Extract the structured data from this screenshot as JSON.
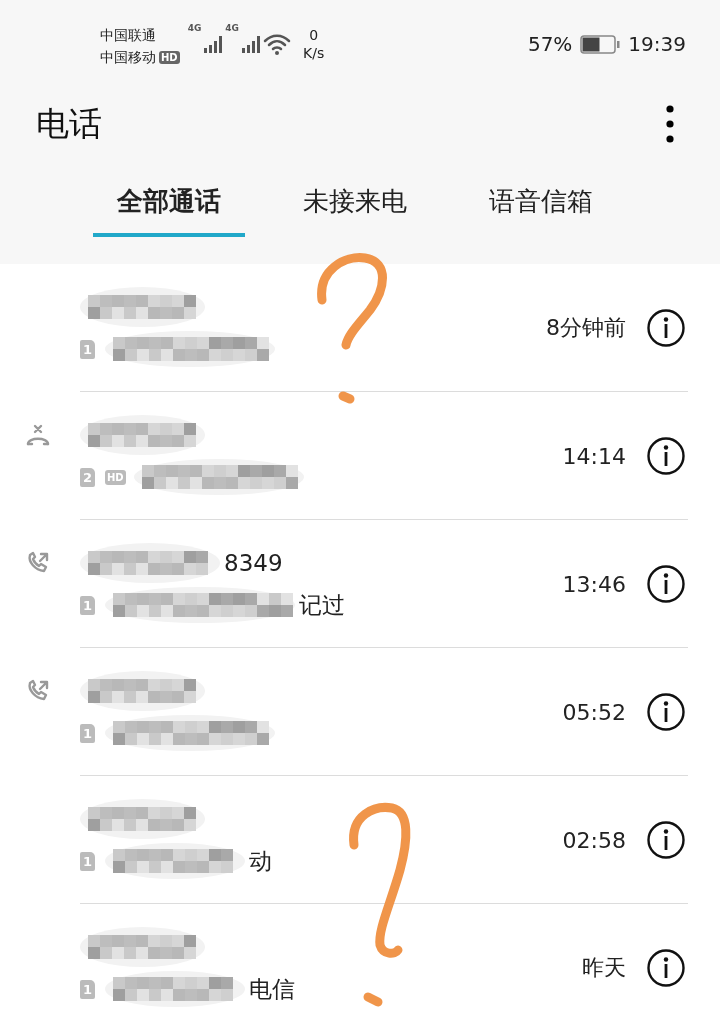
{
  "status_bar": {
    "carriers": [
      {
        "name": "中国联通"
      },
      {
        "name": "中国移动",
        "hd": "HD"
      }
    ],
    "network": [
      "4G",
      "4G"
    ],
    "speed_value": "0",
    "speed_unit": "K/s",
    "battery_text": "57%",
    "battery": {
      "level": 0.57
    },
    "time": "19:39"
  },
  "header": {
    "title": "电话"
  },
  "tabs": [
    {
      "label": "全部通话",
      "selected": true
    },
    {
      "label": "未接来电",
      "selected": false
    },
    {
      "label": "语音信箱",
      "selected": false
    }
  ],
  "calls": [
    {
      "kind": "none",
      "sim": "1",
      "time": "8分钟前"
    },
    {
      "kind": "declined",
      "sim": "2",
      "hd": "HD",
      "time": "14:14"
    },
    {
      "kind": "outgoing",
      "name_visible": "8349",
      "sim": "1",
      "detail_visible": "记过",
      "time": "13:46"
    },
    {
      "kind": "outgoing",
      "sim": "1",
      "time": "05:52"
    },
    {
      "kind": "none",
      "sim": "1",
      "detail_visible": "动",
      "time": "02:58"
    },
    {
      "kind": "none",
      "sim": "1",
      "detail_visible": "电信",
      "time": "昨天"
    }
  ]
}
